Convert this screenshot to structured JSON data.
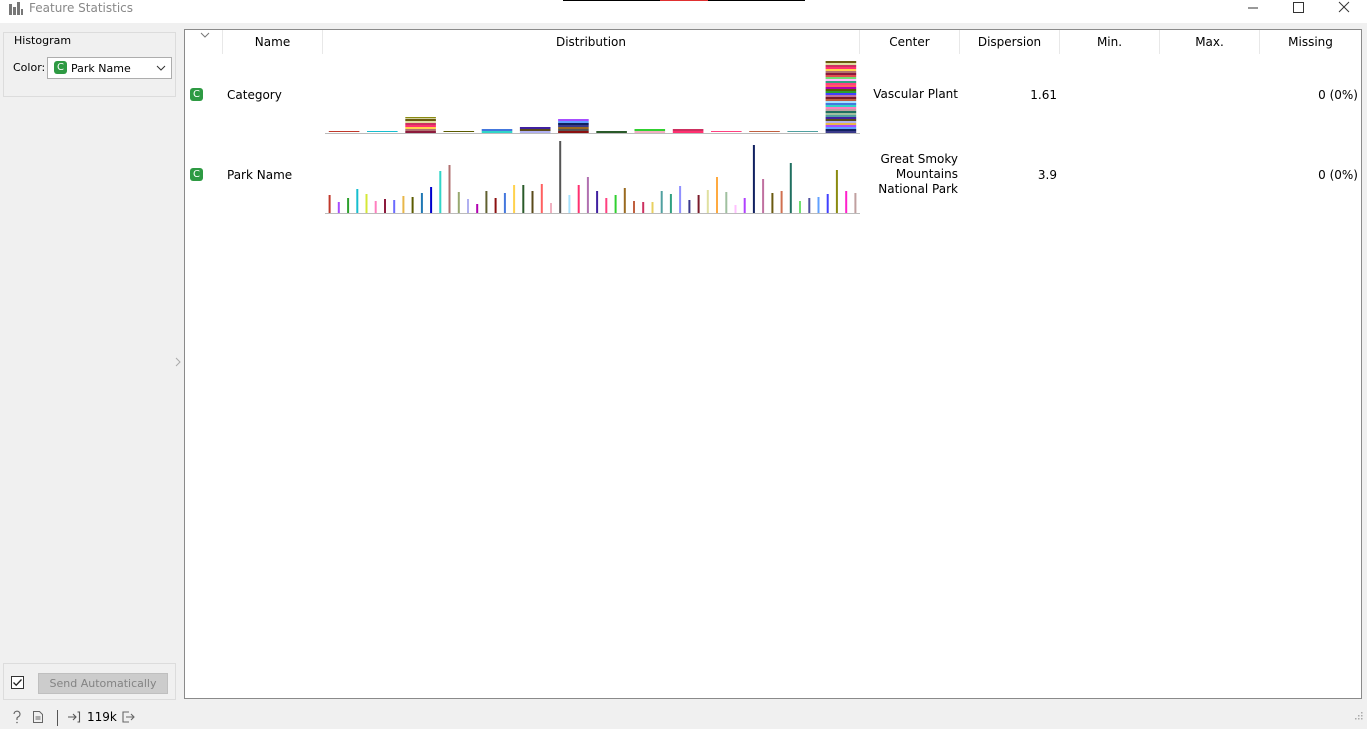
{
  "window": {
    "title": "Feature Statistics",
    "controls": [
      "minimize-icon",
      "maximize-icon",
      "close-icon"
    ]
  },
  "sidebar": {
    "histogram_label": "Histogram",
    "color_label": "Color:",
    "color_select": {
      "badge": "C",
      "value": "Park Name"
    },
    "send_checkbox_checked": true,
    "send_button": "Send Automatically"
  },
  "table": {
    "headers": {
      "name": "Name",
      "distribution": "Distribution",
      "center": "Center",
      "dispersion": "Dispersion",
      "min": "Min.",
      "max": "Max.",
      "missing": "Missing"
    },
    "rows": [
      {
        "badge": "C",
        "name": "Category",
        "center": "Vascular Plant",
        "dispersion": "1.61",
        "min": "",
        "max": "",
        "missing": "0 (0%)",
        "distribution": {
          "type": "stacked-bar",
          "values": [
            1,
            1,
            15,
            1,
            4,
            6,
            14,
            2,
            4,
            4,
            1,
            1,
            1,
            70
          ]
        }
      },
      {
        "badge": "C",
        "name": "Park Name",
        "center": "Great Smoky\nMountains\nNational Park",
        "dispersion": "3.9",
        "min": "",
        "max": "",
        "missing": "0 (0%)",
        "distribution": {
          "type": "bar",
          "values": [
            18,
            11,
            15,
            24,
            19,
            12,
            14,
            13,
            17,
            16,
            20,
            26,
            42,
            48,
            21,
            14,
            9,
            22,
            15,
            20,
            28,
            28,
            22,
            29,
            10,
            72,
            18,
            28,
            36,
            22,
            15,
            18,
            25,
            12,
            11,
            11,
            22,
            19,
            27,
            13,
            18,
            23,
            36,
            21,
            8,
            15,
            68,
            34,
            20,
            22,
            50,
            12,
            15,
            16,
            19,
            43,
            22,
            20
          ]
        }
      }
    ]
  },
  "status": {
    "count": "119k",
    "icons": [
      "help-icon",
      "report-icon",
      "input-icon",
      "output-icon"
    ]
  },
  "colors": {
    "badge_green": "#2e9a43",
    "park_bars": [
      "#c0392b",
      "#a64dff",
      "#2ca02c",
      "#17becf",
      "#d5e837",
      "#ff7fbf",
      "#8c1a3c",
      "#6b6bff",
      "#e8b74a",
      "#5b5b00",
      "#1f77b4",
      "#0000cc",
      "#30d5c8",
      "#b07070",
      "#98a870",
      "#b0b0f0",
      "#b000b0",
      "#606030",
      "#8b1010",
      "#4477dd",
      "#ffd24d",
      "#2a5a2a",
      "#5a4a1a",
      "#ff6060",
      "#f0b0c0",
      "#555555",
      "#a6e2ff",
      "#ff3070",
      "#b070b0",
      "#4020a0",
      "#ff4080",
      "#30d030",
      "#9a6a20",
      "#c06040",
      "#cc3060",
      "#e8d060",
      "#50a0a0",
      "#30a080",
      "#9090ff",
      "#3a3a8a",
      "#7a1a2a",
      "#e0e0a0",
      "#ffaa40",
      "#a0c0a0",
      "#ffc0ff",
      "#b040ff",
      "#102060",
      "#c070a0",
      "#6a5a10",
      "#d07050",
      "#207060",
      "#70e070",
      "#5050a0",
      "#60a0ff",
      "#4040ff",
      "#8a8a10",
      "#ff20cc",
      "#c0a0a0",
      "#e05050"
    ]
  }
}
